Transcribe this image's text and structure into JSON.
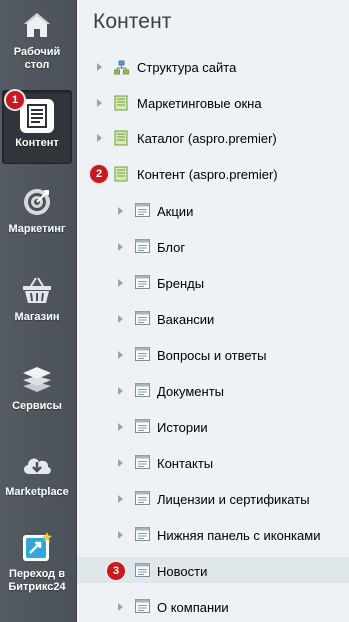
{
  "sidebar": {
    "items": [
      {
        "label_line1": "Рабочий",
        "label_line2": "стол",
        "icon": "home-icon"
      },
      {
        "label_line1": "Контент",
        "label_line2": "",
        "icon": "document-icon",
        "active": true
      },
      {
        "label_line1": "Маркетинг",
        "label_line2": "",
        "icon": "target-icon"
      },
      {
        "label_line1": "Магазин",
        "label_line2": "",
        "icon": "basket-icon"
      },
      {
        "label_line1": "Сервисы",
        "label_line2": "",
        "icon": "layers-icon"
      },
      {
        "label_line1": "Marketplace",
        "label_line2": "",
        "icon": "cloud-download-icon"
      },
      {
        "label_line1": "Переход в",
        "label_line2": "Битрикс24",
        "icon": "bitrix24-icon"
      }
    ]
  },
  "main": {
    "title": "Контент",
    "tree": [
      {
        "label": "Структура сайта",
        "icon": "site-structure-icon",
        "level": 0
      },
      {
        "label": "Маркетинговые окна",
        "icon": "infoblock-type-icon",
        "level": 0
      },
      {
        "label": "Каталог (aspro.premier)",
        "icon": "infoblock-type-icon",
        "level": 0
      },
      {
        "label": "Контент (aspro.premier)",
        "icon": "infoblock-type-icon",
        "level": 0
      },
      {
        "label": "Акции",
        "icon": "infoblock-icon",
        "level": 1
      },
      {
        "label": "Блог",
        "icon": "infoblock-icon",
        "level": 1
      },
      {
        "label": "Бренды",
        "icon": "infoblock-icon",
        "level": 1
      },
      {
        "label": "Вакансии",
        "icon": "infoblock-icon",
        "level": 1
      },
      {
        "label": "Вопросы и ответы",
        "icon": "infoblock-icon",
        "level": 1
      },
      {
        "label": "Документы",
        "icon": "infoblock-icon",
        "level": 1
      },
      {
        "label": "Истории",
        "icon": "infoblock-icon",
        "level": 1
      },
      {
        "label": "Контакты",
        "icon": "infoblock-icon",
        "level": 1
      },
      {
        "label": "Лицензии и сертификаты",
        "icon": "infoblock-icon",
        "level": 1
      },
      {
        "label": "Нижняя панель с иконками",
        "icon": "infoblock-icon",
        "level": 1
      },
      {
        "label": "Новости",
        "icon": "infoblock-icon",
        "level": 1,
        "selected": true
      },
      {
        "label": "О компании",
        "icon": "infoblock-icon",
        "level": 1
      }
    ]
  },
  "badges": [
    "1",
    "2",
    "3"
  ],
  "colors": {
    "badge": "#c8191e",
    "sidebar": "#4a5159",
    "selected_row": "#dfe7ea"
  }
}
